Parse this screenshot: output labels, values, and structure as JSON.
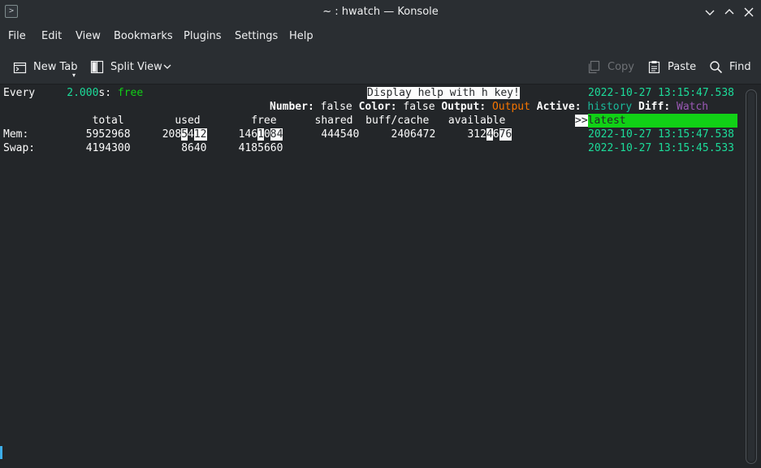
{
  "window": {
    "title": "~ : hwatch — Konsole",
    "icon": "terminal-icon",
    "prompt_glyph": ">",
    "controls": [
      "minimize-icon",
      "maximize-icon",
      "close-icon"
    ]
  },
  "menubar": {
    "items": [
      "File",
      "Edit",
      "View",
      "Bookmarks",
      "Plugins",
      "Settings",
      "Help"
    ]
  },
  "toolbar": {
    "new_tab": "New Tab",
    "split_view": "Split View",
    "copy": "Copy",
    "paste": "Paste",
    "find": "Find"
  },
  "terminal": {
    "header": {
      "every": "Every",
      "interval": "2.000",
      "interval_unit": "s:",
      "command": "free",
      "help": "Display help with h key!",
      "timestamp": "2022-10-27 13:15:47.538"
    },
    "status": {
      "number_label": "Number:",
      "number_value": "false",
      "color_label": "Color:",
      "color_value": "false",
      "output_label": "Output:",
      "output_value": "Output",
      "active_label": "Active:",
      "active_value": "history",
      "diff_label": "Diff:",
      "diff_value": "Watch"
    },
    "columns": {
      "text": "              total        used        free      shared  buff/cache   available"
    },
    "history": {
      "marker": ">>",
      "latest": "latest",
      "entries": [
        "2022-10-27 13:15:47.538",
        "2022-10-27 13:15:45.533"
      ]
    },
    "mem": {
      "label": "Mem:",
      "total": "5952968",
      "used": [
        "208",
        "5",
        "4",
        "12"
      ],
      "free": [
        "146",
        "1",
        "0",
        "84"
      ],
      "shared": "444540",
      "buff_cache": "2406472",
      "available": [
        "312",
        "4",
        "6",
        "76"
      ]
    },
    "swap": {
      "label": "Swap:",
      "total": "4194300",
      "used": "8640",
      "free": "4185660"
    }
  },
  "colors": {
    "background": "#232629",
    "chrome": "#2a2e32",
    "green": "#11d116",
    "cyan": "#1cdc9a",
    "orange": "#f67400",
    "purple": "#9b59b6",
    "accent": "#3daee9"
  }
}
